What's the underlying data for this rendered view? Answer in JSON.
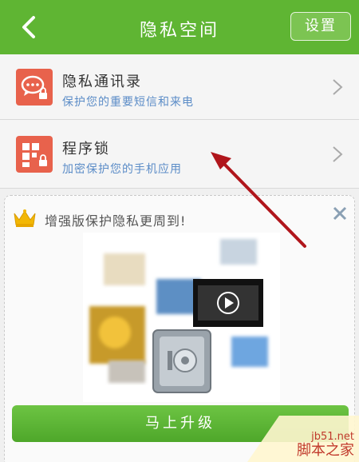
{
  "header": {
    "title": "隐私空间",
    "settings_label": "设置",
    "back_icon": "chevron-left-icon",
    "bg_color": "#5fb533"
  },
  "list": [
    {
      "title": "隐私通讯录",
      "subtitle": "保护您的重要短信和来电",
      "icon": "chat-lock-icon"
    },
    {
      "title": "程序锁",
      "subtitle": "加密保护您的手机应用",
      "icon": "apps-lock-icon"
    }
  ],
  "promo": {
    "text": "增强版保护隐私更周到!",
    "upgrade_label": "马上升级",
    "crown_icon": "crown-icon",
    "close_icon": "close-icon"
  },
  "watermark": {
    "site": "jb51.net",
    "name": "脚本之家"
  },
  "colors": {
    "accent_green": "#5fb533",
    "icon_red": "#e8624c",
    "subtitle_blue": "#5b8cc7",
    "arrow_red": "#b0161c"
  }
}
